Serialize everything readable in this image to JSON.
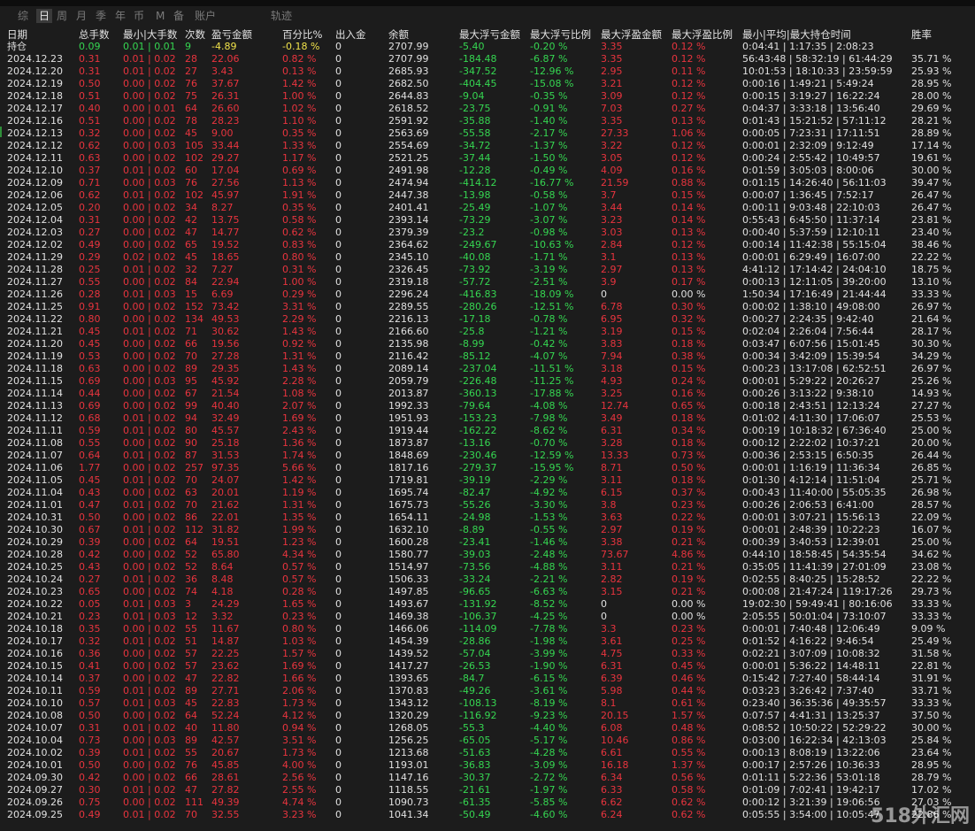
{
  "tabs": [
    "综",
    "日",
    "周",
    "月",
    "季",
    "年",
    "币",
    "M",
    "备",
    "账户",
    "轨迹"
  ],
  "active_tab": "日",
  "headers": [
    "日期",
    "总手数",
    "最小|大手数",
    "次数",
    "盈亏金额",
    "百分比%",
    "出入金",
    "余额",
    "最大浮亏金额",
    "最大浮亏比例",
    "最大浮盈金额",
    "最大浮盈比例",
    "最小|平均|最大持仓时间",
    "胜率"
  ],
  "summary": {
    "date": "持仓",
    "lots": "0.09",
    "minmax": "0.01 | 0.01",
    "count": "9",
    "pnl": "-4.89",
    "pct": "-0.18 %",
    "inout": "0",
    "balance": "2707.99",
    "maxloss": "-5.40",
    "maxloss_pct": "-0.20 %",
    "maxprofit": "3.35",
    "maxprofit_pct": "0.12 %",
    "hold": "0:04:41 | 1:17:35 | 2:08:23",
    "winrate": ""
  },
  "rows": [
    [
      "2024.12.23",
      "0.31",
      "0.01 | 0.02",
      "28",
      "22.06",
      "0.82 %",
      "0",
      "2707.99",
      "-184.48",
      "-6.87 %",
      "3.35",
      "0.12 %",
      "56:43:48 | 58:32:19 | 61:44:29",
      "35.71 %"
    ],
    [
      "2024.12.20",
      "0.31",
      "0.01 | 0.02",
      "27",
      "3.43",
      "0.13 %",
      "0",
      "2685.93",
      "-347.52",
      "-12.96 %",
      "2.95",
      "0.11 %",
      "10:01:53 | 18:10:33 | 23:59:59",
      "25.93 %"
    ],
    [
      "2024.12.19",
      "0.50",
      "0.00 | 0.02",
      "76",
      "37.67",
      "1.42 %",
      "0",
      "2682.50",
      "-404.45",
      "-15.08 %",
      "3.21",
      "0.12 %",
      "0:00:16 | 1:49:21 | 5:49:24",
      "28.95 %"
    ],
    [
      "2024.12.18",
      "0.51",
      "0.00 | 0.02",
      "75",
      "26.31",
      "1.00 %",
      "0",
      "2644.83",
      "-9.04",
      "-0.35 %",
      "3.09",
      "0.12 %",
      "0:00:15 | 3:19:27 | 16:22:24",
      "28.00 %"
    ],
    [
      "2024.12.17",
      "0.40",
      "0.00 | 0.01",
      "64",
      "26.60",
      "1.02 %",
      "0",
      "2618.52",
      "-23.75",
      "-0.91 %",
      "7.03",
      "0.27 %",
      "0:04:37 | 3:33:18 | 13:56:40",
      "29.69 %"
    ],
    [
      "2024.12.16",
      "0.51",
      "0.00 | 0.02",
      "78",
      "28.23",
      "1.10 %",
      "0",
      "2591.92",
      "-35.88",
      "-1.40 %",
      "3.35",
      "0.13 %",
      "0:01:43 | 15:21:52 | 57:11:12",
      "28.21 %"
    ],
    [
      "2024.12.13",
      "0.32",
      "0.00 | 0.02",
      "45",
      "9.00",
      "0.35 %",
      "0",
      "2563.69",
      "-55.58",
      "-2.17 %",
      "27.33",
      "1.06 %",
      "0:00:05 | 7:23:31 | 17:11:51",
      "28.89 %"
    ],
    [
      "2024.12.12",
      "0.62",
      "0.00 | 0.03",
      "105",
      "33.44",
      "1.33 %",
      "0",
      "2554.69",
      "-34.72",
      "-1.37 %",
      "3.22",
      "0.12 %",
      "0:00:01 | 2:32:09 | 9:12:49",
      "17.14 %"
    ],
    [
      "2024.12.11",
      "0.63",
      "0.00 | 0.02",
      "102",
      "29.27",
      "1.17 %",
      "0",
      "2521.25",
      "-37.44",
      "-1.50 %",
      "3.05",
      "0.12 %",
      "0:00:24 | 2:55:42 | 10:49:57",
      "19.61 %"
    ],
    [
      "2024.12.10",
      "0.37",
      "0.01 | 0.02",
      "60",
      "17.04",
      "0.69 %",
      "0",
      "2491.98",
      "-12.28",
      "-0.49 %",
      "4.09",
      "0.16 %",
      "0:01:59 | 3:05:03 | 8:00:06",
      "30.00 %"
    ],
    [
      "2024.12.09",
      "0.71",
      "0.00 | 0.03",
      "76",
      "27.56",
      "1.13 %",
      "0",
      "2474.94",
      "-414.12",
      "-16.77 %",
      "21.59",
      "0.88 %",
      "0:01:15 | 14:26:40 | 56:11:03",
      "39.47 %"
    ],
    [
      "2024.12.06",
      "0.62",
      "0.01 | 0.02",
      "102",
      "45.97",
      "1.91 %",
      "0",
      "2447.38",
      "-13.98",
      "-0.58 %",
      "3.7",
      "0.15 %",
      "0:00:07 | 1:36:45 | 7:52:17",
      "26.47 %"
    ],
    [
      "2024.12.05",
      "0.20",
      "0.00 | 0.02",
      "34",
      "8.27",
      "0.35 %",
      "0",
      "2401.41",
      "-25.49",
      "-1.07 %",
      "3.44",
      "0.14 %",
      "0:00:11 | 9:03:48 | 22:10:03",
      "26.47 %"
    ],
    [
      "2024.12.04",
      "0.31",
      "0.00 | 0.02",
      "42",
      "13.75",
      "0.58 %",
      "0",
      "2393.14",
      "-73.29",
      "-3.07 %",
      "3.23",
      "0.14 %",
      "0:55:43 | 6:45:50 | 11:37:14",
      "23.81 %"
    ],
    [
      "2024.12.03",
      "0.27",
      "0.00 | 0.02",
      "47",
      "14.77",
      "0.62 %",
      "0",
      "2379.39",
      "-23.2",
      "-0.98 %",
      "3.03",
      "0.13 %",
      "0:00:40 | 5:37:59 | 12:10:11",
      "23.40 %"
    ],
    [
      "2024.12.02",
      "0.49",
      "0.00 | 0.02",
      "65",
      "19.52",
      "0.83 %",
      "0",
      "2364.62",
      "-249.67",
      "-10.63 %",
      "2.84",
      "0.12 %",
      "0:00:14 | 11:42:38 | 55:15:04",
      "38.46 %"
    ],
    [
      "2024.11.29",
      "0.29",
      "0.02 | 0.02",
      "45",
      "18.65",
      "0.80 %",
      "0",
      "2345.10",
      "-40.08",
      "-1.71 %",
      "3.1",
      "0.13 %",
      "0:00:01 | 6:29:49 | 16:07:00",
      "22.22 %"
    ],
    [
      "2024.11.28",
      "0.25",
      "0.01 | 0.02",
      "32",
      "7.27",
      "0.31 %",
      "0",
      "2326.45",
      "-73.92",
      "-3.19 %",
      "2.97",
      "0.13 %",
      "4:41:12 | 17:14:42 | 24:04:10",
      "18.75 %"
    ],
    [
      "2024.11.27",
      "0.55",
      "0.00 | 0.02",
      "84",
      "22.94",
      "1.00 %",
      "0",
      "2319.18",
      "-57.72",
      "-2.51 %",
      "3.9",
      "0.17 %",
      "0:00:13 | 12:11:05 | 39:20:00",
      "13.10 %"
    ],
    [
      "2024.11.26",
      "0.28",
      "0.01 | 0.03",
      "15",
      "6.69",
      "0.29 %",
      "0",
      "2296.24",
      "-416.83",
      "-18.09 %",
      "0",
      "0.00 %",
      "1:50:34 | 17:16:49 | 21:44:44",
      "33.33 %"
    ],
    [
      "2024.11.25",
      "0.91",
      "0.00 | 0.02",
      "152",
      "73.42",
      "3.31 %",
      "0",
      "2289.55",
      "-280.26",
      "-12.51 %",
      "6.78",
      "0.30 %",
      "0:00:02 | 1:38:10 | 49:08:00",
      "26.97 %"
    ],
    [
      "2024.11.22",
      "0.80",
      "0.00 | 0.02",
      "134",
      "49.53",
      "2.29 %",
      "0",
      "2216.13",
      "-17.18",
      "-0.78 %",
      "6.95",
      "0.32 %",
      "0:00:27 | 2:24:35 | 9:42:40",
      "21.64 %"
    ],
    [
      "2024.11.21",
      "0.45",
      "0.01 | 0.02",
      "71",
      "30.62",
      "1.43 %",
      "0",
      "2166.60",
      "-25.8",
      "-1.21 %",
      "3.19",
      "0.15 %",
      "0:02:04 | 2:26:04 | 7:56:44",
      "28.17 %"
    ],
    [
      "2024.11.20",
      "0.45",
      "0.00 | 0.02",
      "66",
      "19.56",
      "0.92 %",
      "0",
      "2135.98",
      "-8.99",
      "-0.42 %",
      "3.83",
      "0.18 %",
      "0:03:47 | 6:07:56 | 15:01:45",
      "30.30 %"
    ],
    [
      "2024.11.19",
      "0.53",
      "0.00 | 0.02",
      "70",
      "27.28",
      "1.31 %",
      "0",
      "2116.42",
      "-85.12",
      "-4.07 %",
      "7.94",
      "0.38 %",
      "0:00:34 | 3:42:09 | 15:39:54",
      "34.29 %"
    ],
    [
      "2024.11.18",
      "0.63",
      "0.00 | 0.02",
      "89",
      "29.35",
      "1.43 %",
      "0",
      "2089.14",
      "-237.04",
      "-11.51 %",
      "3.18",
      "0.15 %",
      "0:00:23 | 13:17:08 | 62:52:51",
      "26.97 %"
    ],
    [
      "2024.11.15",
      "0.69",
      "0.00 | 0.03",
      "95",
      "45.92",
      "2.28 %",
      "0",
      "2059.79",
      "-226.48",
      "-11.25 %",
      "4.93",
      "0.24 %",
      "0:00:01 | 5:29:22 | 20:26:27",
      "25.26 %"
    ],
    [
      "2024.11.14",
      "0.44",
      "0.00 | 0.02",
      "67",
      "21.54",
      "1.08 %",
      "0",
      "2013.87",
      "-360.13",
      "-17.88 %",
      "3.25",
      "0.16 %",
      "0:00:26 | 3:13:22 | 9:38:10",
      "14.93 %"
    ],
    [
      "2024.11.13",
      "0.69",
      "0.00 | 0.02",
      "99",
      "40.40",
      "2.07 %",
      "0",
      "1992.33",
      "-79.64",
      "-4.08 %",
      "12.74",
      "0.65 %",
      "0:00:18 | 2:43:51 | 12:13:24",
      "27.27 %"
    ],
    [
      "2024.11.12",
      "0.68",
      "0.01 | 0.02",
      "94",
      "32.49",
      "1.69 %",
      "0",
      "1951.93",
      "-153.23",
      "-7.98 %",
      "3.49",
      "0.18 %",
      "0:01:02 | 4:11:30 | 17:06:07",
      "25.53 %"
    ],
    [
      "2024.11.11",
      "0.59",
      "0.01 | 0.02",
      "80",
      "45.57",
      "2.43 %",
      "0",
      "1919.44",
      "-162.22",
      "-8.62 %",
      "6.31",
      "0.34 %",
      "0:00:19 | 10:18:32 | 67:36:40",
      "25.00 %"
    ],
    [
      "2024.11.08",
      "0.55",
      "0.00 | 0.02",
      "90",
      "25.18",
      "1.36 %",
      "0",
      "1873.87",
      "-13.16",
      "-0.70 %",
      "3.28",
      "0.18 %",
      "0:00:12 | 2:22:02 | 10:37:21",
      "20.00 %"
    ],
    [
      "2024.11.07",
      "0.64",
      "0.01 | 0.02",
      "87",
      "31.53",
      "1.74 %",
      "0",
      "1848.69",
      "-230.46",
      "-12.59 %",
      "13.33",
      "0.73 %",
      "0:00:36 | 2:53:15 | 6:50:35",
      "26.44 %"
    ],
    [
      "2024.11.06",
      "1.77",
      "0.00 | 0.02",
      "257",
      "97.35",
      "5.66 %",
      "0",
      "1817.16",
      "-279.37",
      "-15.95 %",
      "8.71",
      "0.50 %",
      "0:00:01 | 1:16:19 | 11:36:34",
      "26.85 %"
    ],
    [
      "2024.11.05",
      "0.45",
      "0.01 | 0.02",
      "70",
      "24.07",
      "1.42 %",
      "0",
      "1719.81",
      "-39.19",
      "-2.29 %",
      "3.11",
      "0.18 %",
      "0:01:30 | 4:12:14 | 11:51:04",
      "25.71 %"
    ],
    [
      "2024.11.04",
      "0.43",
      "0.00 | 0.02",
      "63",
      "20.01",
      "1.19 %",
      "0",
      "1695.74",
      "-82.47",
      "-4.92 %",
      "6.15",
      "0.37 %",
      "0:00:43 | 11:40:00 | 55:05:35",
      "26.98 %"
    ],
    [
      "2024.11.01",
      "0.47",
      "0.01 | 0.02",
      "70",
      "21.62",
      "1.31 %",
      "0",
      "1675.73",
      "-55.26",
      "-3.30 %",
      "3.8",
      "0.23 %",
      "0:00:26 | 2:06:53 | 6:41:00",
      "28.57 %"
    ],
    [
      "2024.10.31",
      "0.50",
      "0.00 | 0.02",
      "86",
      "22.01",
      "1.35 %",
      "0",
      "1654.11",
      "-24.98",
      "-1.53 %",
      "3.63",
      "0.22 %",
      "0:00:01 | 3:07:21 | 15:56:13",
      "22.09 %"
    ],
    [
      "2024.10.30",
      "0.67",
      "0.01 | 0.02",
      "112",
      "31.82",
      "1.99 %",
      "0",
      "1632.10",
      "-8.89",
      "-0.55 %",
      "2.97",
      "0.19 %",
      "0:00:01 | 2:48:39 | 10:22:23",
      "16.07 %"
    ],
    [
      "2024.10.29",
      "0.39",
      "0.00 | 0.02",
      "64",
      "19.51",
      "1.23 %",
      "0",
      "1600.28",
      "-23.41",
      "-1.46 %",
      "3.38",
      "0.21 %",
      "0:00:39 | 3:40:53 | 12:39:01",
      "25.00 %"
    ],
    [
      "2024.10.28",
      "0.42",
      "0.00 | 0.02",
      "52",
      "65.80",
      "4.34 %",
      "0",
      "1580.77",
      "-39.03",
      "-2.48 %",
      "73.67",
      "4.86 %",
      "0:44:10 | 18:58:45 | 54:35:54",
      "34.62 %"
    ],
    [
      "2024.10.25",
      "0.43",
      "0.00 | 0.02",
      "52",
      "8.64",
      "0.57 %",
      "0",
      "1514.97",
      "-73.56",
      "-4.88 %",
      "3.11",
      "0.21 %",
      "0:35:05 | 11:41:39 | 27:01:09",
      "23.08 %"
    ],
    [
      "2024.10.24",
      "0.27",
      "0.01 | 0.02",
      "36",
      "8.48",
      "0.57 %",
      "0",
      "1506.33",
      "-33.24",
      "-2.21 %",
      "2.82",
      "0.19 %",
      "0:02:55 | 8:40:25 | 15:28:52",
      "22.22 %"
    ],
    [
      "2024.10.23",
      "0.65",
      "0.00 | 0.02",
      "74",
      "4.18",
      "0.28 %",
      "0",
      "1497.85",
      "-96.65",
      "-6.63 %",
      "3.15",
      "0.21 %",
      "0:00:08 | 21:47:24 | 119:17:26",
      "29.73 %"
    ],
    [
      "2024.10.22",
      "0.05",
      "0.01 | 0.03",
      "3",
      "24.29",
      "1.65 %",
      "0",
      "1493.67",
      "-131.92",
      "-8.52 %",
      "0",
      "0.00 %",
      "19:02:30 | 59:49:41 | 80:16:06",
      "33.33 %"
    ],
    [
      "2024.10.21",
      "0.23",
      "0.01 | 0.03",
      "12",
      "3.32",
      "0.23 %",
      "0",
      "1469.38",
      "-106.37",
      "-4.25 %",
      "0",
      "0.00 %",
      "2:05:55 | 50:01:04 | 73:10:07",
      "33.33 %"
    ],
    [
      "2024.10.18",
      "0.35",
      "0.00 | 0.02",
      "55",
      "11.67",
      "0.80 %",
      "0",
      "1466.06",
      "-114.09",
      "-7.78 %",
      "3.3",
      "0.23 %",
      "0:00:01 | 7:40:48 | 12:06:49",
      "9.09 %"
    ],
    [
      "2024.10.17",
      "0.32",
      "0.01 | 0.02",
      "51",
      "14.87",
      "1.03 %",
      "0",
      "1454.39",
      "-28.86",
      "-1.98 %",
      "3.61",
      "0.25 %",
      "0:01:52 | 4:16:22 | 9:46:54",
      "25.49 %"
    ],
    [
      "2024.10.16",
      "0.36",
      "0.00 | 0.02",
      "57",
      "22.25",
      "1.57 %",
      "0",
      "1439.52",
      "-57.04",
      "-3.99 %",
      "4.75",
      "0.33 %",
      "0:02:21 | 3:07:09 | 10:08:32",
      "31.58 %"
    ],
    [
      "2024.10.15",
      "0.41",
      "0.00 | 0.02",
      "57",
      "23.62",
      "1.69 %",
      "0",
      "1417.27",
      "-26.53",
      "-1.90 %",
      "6.31",
      "0.45 %",
      "0:00:01 | 5:36:22 | 14:48:11",
      "22.81 %"
    ],
    [
      "2024.10.14",
      "0.37",
      "0.00 | 0.02",
      "47",
      "22.82",
      "1.66 %",
      "0",
      "1393.65",
      "-84.7",
      "-6.15 %",
      "6.39",
      "0.46 %",
      "0:15:42 | 7:27:40 | 58:44:14",
      "31.91 %"
    ],
    [
      "2024.10.11",
      "0.59",
      "0.01 | 0.02",
      "89",
      "27.71",
      "2.06 %",
      "0",
      "1370.83",
      "-49.26",
      "-3.61 %",
      "5.98",
      "0.44 %",
      "0:03:23 | 3:26:42 | 7:37:40",
      "33.71 %"
    ],
    [
      "2024.10.10",
      "0.57",
      "0.01 | 0.03",
      "45",
      "22.83",
      "1.73 %",
      "0",
      "1343.12",
      "-108.13",
      "-8.19 %",
      "8.1",
      "0.61 %",
      "0:23:40 | 36:35:36 | 49:35:57",
      "33.33 %"
    ],
    [
      "2024.10.08",
      "0.50",
      "0.00 | 0.02",
      "64",
      "52.24",
      "4.12 %",
      "0",
      "1320.29",
      "-116.92",
      "-9.23 %",
      "20.15",
      "1.57 %",
      "0:07:57 | 4:41:31 | 13:25:37",
      "37.50 %"
    ],
    [
      "2024.10.07",
      "0.31",
      "0.01 | 0.02",
      "40",
      "11.80",
      "0.94 %",
      "0",
      "1268.05",
      "-55.3",
      "-4.40 %",
      "6.08",
      "0.48 %",
      "0:08:52 | 10:50:22 | 52:29:22",
      "30.00 %"
    ],
    [
      "2024.10.04",
      "0.73",
      "0.00 | 0.03",
      "89",
      "42.57",
      "3.51 %",
      "0",
      "1256.25",
      "-65.05",
      "-5.17 %",
      "10.46",
      "0.86 %",
      "0:03:00 | 16:22:34 | 42:13:03",
      "25.84 %"
    ],
    [
      "2024.10.02",
      "0.39",
      "0.01 | 0.02",
      "55",
      "20.67",
      "1.73 %",
      "0",
      "1213.68",
      "-51.63",
      "-4.28 %",
      "6.61",
      "0.55 %",
      "0:00:13 | 8:08:19 | 13:22:06",
      "23.64 %"
    ],
    [
      "2024.10.01",
      "0.50",
      "0.00 | 0.02",
      "76",
      "45.85",
      "4.00 %",
      "0",
      "1193.01",
      "-36.83",
      "-3.09 %",
      "16.18",
      "1.37 %",
      "0:00:17 | 2:57:26 | 10:36:33",
      "28.95 %"
    ],
    [
      "2024.09.30",
      "0.42",
      "0.00 | 0.02",
      "66",
      "28.61",
      "2.56 %",
      "0",
      "1147.16",
      "-30.37",
      "-2.72 %",
      "6.34",
      "0.56 %",
      "0:01:11 | 5:22:36 | 53:01:18",
      "28.79 %"
    ],
    [
      "2024.09.27",
      "0.30",
      "0.01 | 0.02",
      "47",
      "27.82",
      "2.55 %",
      "0",
      "1118.55",
      "-21.61",
      "-1.97 %",
      "6.33",
      "0.58 %",
      "0:01:09 | 7:02:41 | 19:42:17",
      "17.02 %"
    ],
    [
      "2024.09.26",
      "0.75",
      "0.00 | 0.02",
      "111",
      "49.39",
      "4.74 %",
      "0",
      "1090.73",
      "-61.35",
      "-5.85 %",
      "6.62",
      "0.62 %",
      "0:00:12 | 3:21:39 | 19:06:56",
      "27.03 %"
    ],
    [
      "2024.09.25",
      "0.49",
      "0.01 | 0.02",
      "70",
      "32.55",
      "3.23 %",
      "0",
      "1041.34",
      "-50.49",
      "-4.60 %",
      "6.24",
      "0.62 %",
      "0:05:55 | 3:54:00 | 10:05:47",
      "22.86 %"
    ]
  ],
  "watermark": "518外汇网",
  "colors": {
    "background": "#1c1c1c",
    "header": "#e2e2e2",
    "neutral": "#e0e0e0",
    "loss": "#e8343e",
    "profit": "#35d651",
    "highlight": "#f0e24a",
    "active_tab_bg": "#3a3a3a"
  }
}
